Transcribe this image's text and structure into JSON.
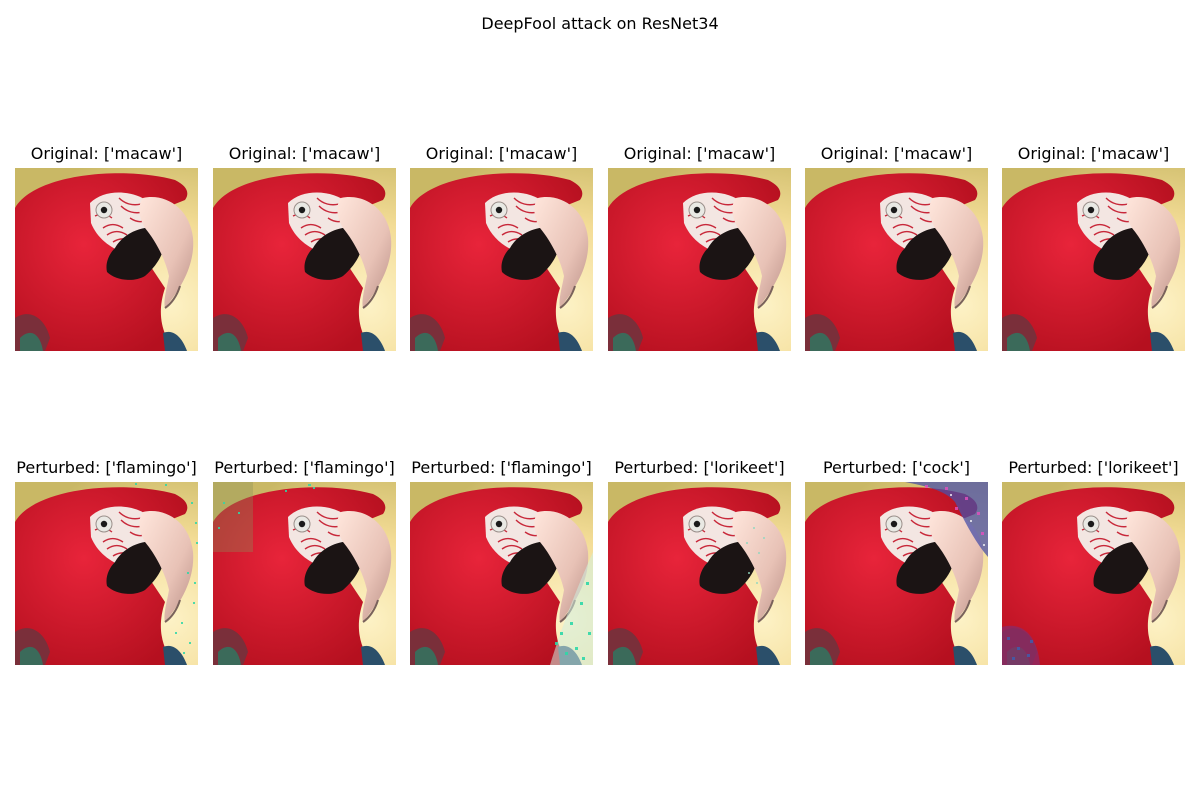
{
  "figure": {
    "title": "DeepFool attack on ResNet34"
  },
  "rows": [
    {
      "panels": [
        {
          "label": "Original: ['macaw']",
          "image": "macaw-photo"
        },
        {
          "label": "Original: ['macaw']",
          "image": "macaw-photo"
        },
        {
          "label": "Original: ['macaw']",
          "image": "macaw-photo"
        },
        {
          "label": "Original: ['macaw']",
          "image": "macaw-photo"
        },
        {
          "label": "Original: ['macaw']",
          "image": "macaw-photo"
        },
        {
          "label": "Original: ['macaw']",
          "image": "macaw-photo"
        }
      ]
    },
    {
      "panels": [
        {
          "label": "Perturbed: ['flamingo']",
          "image": "macaw-photo-perturbed",
          "noise": "right-edge-speckle"
        },
        {
          "label": "Perturbed: ['flamingo']",
          "image": "macaw-photo-perturbed",
          "noise": "top-left-speckle"
        },
        {
          "label": "Perturbed: ['flamingo']",
          "image": "macaw-photo-perturbed",
          "noise": "bottom-right-speckle"
        },
        {
          "label": "Perturbed: ['lorikeet']",
          "image": "macaw-photo-perturbed",
          "noise": "beak-speckle"
        },
        {
          "label": "Perturbed: ['cock']",
          "image": "macaw-photo-perturbed",
          "noise": "top-right-noise-patch"
        },
        {
          "label": "Perturbed: ['lorikeet']",
          "image": "macaw-photo-perturbed",
          "noise": "bottom-left-noise-patch"
        }
      ]
    }
  ]
}
